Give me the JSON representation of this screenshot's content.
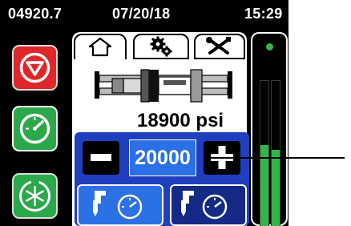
{
  "status_bar": {
    "counter": "04920.7",
    "date": "07/20/18",
    "time": "15:29"
  },
  "tabs": [
    {
      "icon": "home-icon",
      "selected": true
    },
    {
      "icon": "gears-icon",
      "selected": false
    },
    {
      "icon": "tools-icon",
      "selected": false
    }
  ],
  "left_buttons": [
    {
      "icon": "stop-icon",
      "color": "#e0262a"
    },
    {
      "icon": "gauge-icon",
      "color": "#2aa84a"
    },
    {
      "icon": "snowflake-cycle-icon",
      "color": "#2aa84a"
    }
  ],
  "pump_display": {
    "pressure_value": "18900 psi"
  },
  "setpoint": {
    "value": "20000",
    "decrement_symbol": "−",
    "increment_symbol": "+"
  },
  "mode_buttons": [
    {
      "icon": "gun-gauge-icon",
      "selected": true
    },
    {
      "icon": "gun-gauge-icon",
      "selected": false
    }
  ],
  "level_bars": {
    "indicator_color": "#2fb84a",
    "levels": [
      0.58,
      0.55
    ]
  },
  "colors": {
    "accent_blue": "#2c70e6",
    "panel_blue": "#1f3fbf",
    "dark_blue": "#152a86",
    "stop_red": "#e0262a",
    "ok_green": "#2fb84a"
  }
}
